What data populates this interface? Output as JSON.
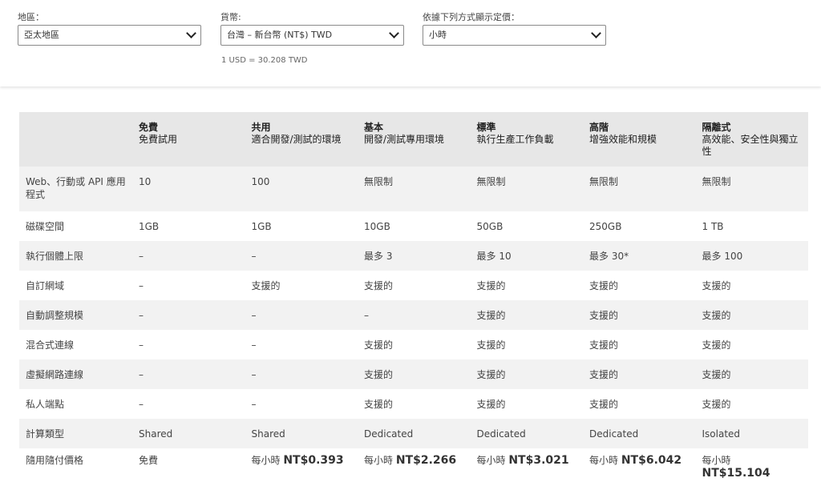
{
  "filters": {
    "region": {
      "label": "地區：",
      "value": "亞太地區"
    },
    "currency": {
      "label": "貨幣:",
      "value": "台灣 – 新台幣 (NT$) TWD"
    },
    "display": {
      "label": "依據下列方式顯示定價：",
      "value": "小時"
    },
    "exchange_rate": "1 USD = 30.208 TWD"
  },
  "tiers": [
    {
      "name": "免費",
      "desc": "免費試用"
    },
    {
      "name": "共用",
      "desc": "適合開發/測試的環境"
    },
    {
      "name": "基本",
      "desc": "開發/測試專用環境"
    },
    {
      "name": "標準",
      "desc": "執行生產工作負載"
    },
    {
      "name": "高階",
      "desc": "增強效能和規模"
    },
    {
      "name": "隔離式",
      "desc": "高效能、安全性與獨立性"
    }
  ],
  "rows": [
    {
      "label": "Web、行動或 API 應用程式",
      "cells": [
        "10",
        "100",
        "無限制",
        "無限制",
        "無限制",
        "無限制"
      ]
    },
    {
      "label": "磁碟空間",
      "cells": [
        "1GB",
        "1GB",
        "10GB",
        "50GB",
        "250GB",
        "1 TB"
      ]
    },
    {
      "label": "執行個體上限",
      "cells": [
        "–",
        "–",
        "最多 3",
        "最多 10",
        "最多 30*",
        "最多 100"
      ]
    },
    {
      "label": "自訂網域",
      "cells": [
        "–",
        "支援的",
        "支援的",
        "支援的",
        "支援的",
        "支援的"
      ]
    },
    {
      "label": "自動調整規模",
      "cells": [
        "–",
        "–",
        "–",
        "支援的",
        "支援的",
        "支援的"
      ]
    },
    {
      "label": "混合式連線",
      "cells": [
        "–",
        "–",
        "支援的",
        "支援的",
        "支援的",
        "支援的"
      ]
    },
    {
      "label": "虛擬網路連線",
      "cells": [
        "–",
        "–",
        "支援的",
        "支援的",
        "支援的",
        "支援的"
      ]
    },
    {
      "label": "私人端點",
      "cells": [
        "–",
        "–",
        "支援的",
        "支援的",
        "支援的",
        "支援的"
      ]
    },
    {
      "label": "計算類型",
      "cells": [
        "Shared",
        "Shared",
        "Dedicated",
        "Dedicated",
        "Dedicated",
        "Isolated"
      ]
    }
  ],
  "price_row": {
    "label": "隨用隨付價格",
    "free": "免費",
    "prefix": "每小時",
    "prices": [
      "NT$0.393",
      "NT$2.266",
      "NT$3.021",
      "NT$6.042",
      "NT$15.104"
    ]
  }
}
